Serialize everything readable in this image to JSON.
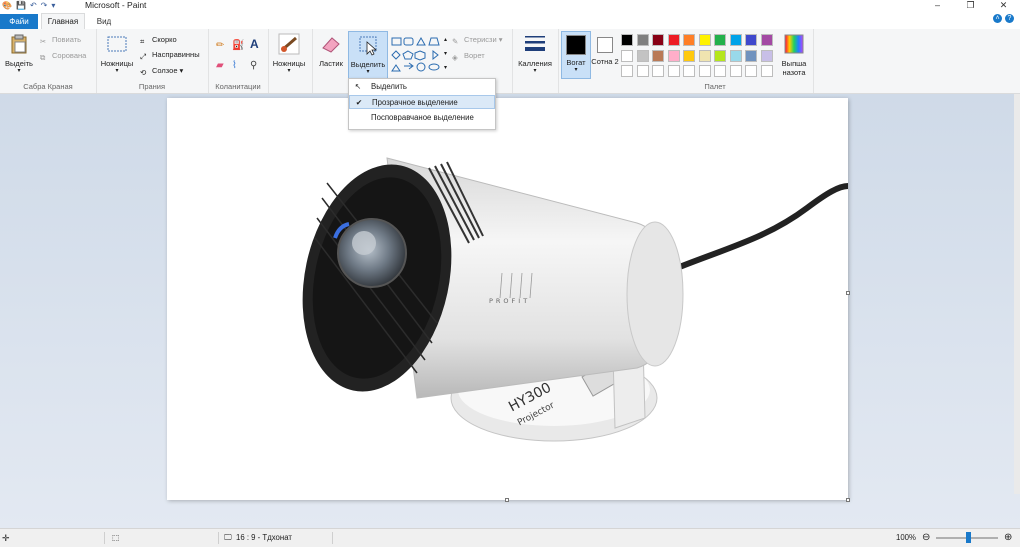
{
  "window": {
    "title": "Microsoft - Paint"
  },
  "tabs": {
    "file": "Файи",
    "home": "Главная",
    "view": "Вид"
  },
  "ribbon": {
    "clipboard": {
      "label": "Сабра Краная",
      "paste": "Выдеіть",
      "cut": "Повиать",
      "copy": "Сорована"
    },
    "image": {
      "label": "Прания",
      "select": "Ножницы",
      "crop": "Скорко",
      "resize": "Насправинны",
      "rotate": "Солзое"
    },
    "tools": {
      "label": "Коланитации"
    },
    "brushes": {
      "label": "Ножницы"
    },
    "eraser": {
      "label": "Ластик"
    },
    "select": {
      "label": "Выделить"
    },
    "shapes": {
      "outline": "Стерисзи",
      "fill": "Ворет"
    },
    "size": {
      "label": "Калления"
    },
    "color1": {
      "label": "Вогат"
    },
    "color2": {
      "label": "Сотна 2"
    },
    "palette": {
      "label": "Палет",
      "row1": [
        "#000000",
        "#7f7f7f",
        "#880015",
        "#ed1c24",
        "#ff7f27",
        "#fff200",
        "#22b14c",
        "#00a2e8",
        "#3f48cc",
        "#a349a4"
      ],
      "row2": [
        "#ffffff",
        "#c3c3c3",
        "#b97a57",
        "#ffaec9",
        "#ffc90e",
        "#efe4b0",
        "#b5e61d",
        "#99d9ea",
        "#7092be",
        "#c8bfe7"
      ],
      "row3": [
        "#ffffff",
        "#ffffff",
        "#ffffff",
        "#ffffff",
        "#ffffff",
        "#ffffff",
        "#ffffff",
        "#ffffff",
        "#ffffff",
        "#ffffff"
      ]
    },
    "edit_colors": "Выпша назота"
  },
  "dropdown": {
    "items": [
      {
        "label": "Выделить",
        "checked": false
      },
      {
        "label": "Прозрачное выделение",
        "checked": true
      },
      {
        "label": "Посповравчаное выделение",
        "checked": false
      }
    ]
  },
  "canvas": {
    "label_brand": "PROFIT",
    "label_model": "HY300",
    "label_product": "Projector"
  },
  "status": {
    "ratio": "16 : 9 - Тдхонат",
    "zoom": "100%"
  },
  "colors": {
    "accent": "#1979ca",
    "select_bg": "#c9e0f7"
  }
}
